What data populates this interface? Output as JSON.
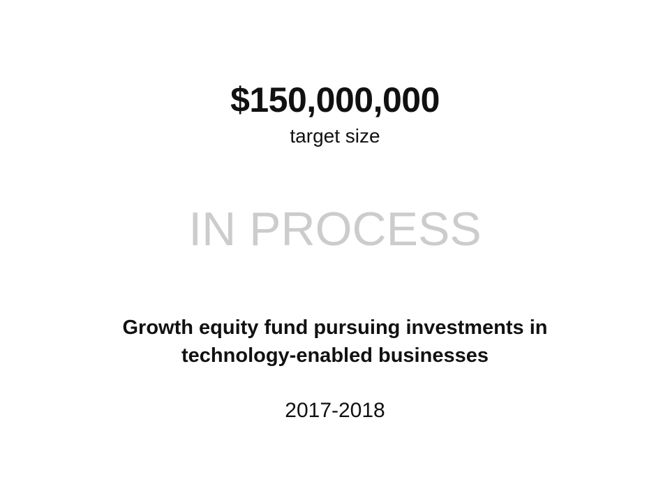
{
  "fund": {
    "target_amount": "$150,000,000",
    "target_caption": "target size",
    "status": "IN PROCESS",
    "description_lines": [
      "Growth equity fund pursuing investments in",
      "technology-enabled businesses"
    ],
    "years": "2017-2018"
  },
  "colors": {
    "background": "#ffffff",
    "text": "#111111",
    "status_text": "#cccccc"
  }
}
